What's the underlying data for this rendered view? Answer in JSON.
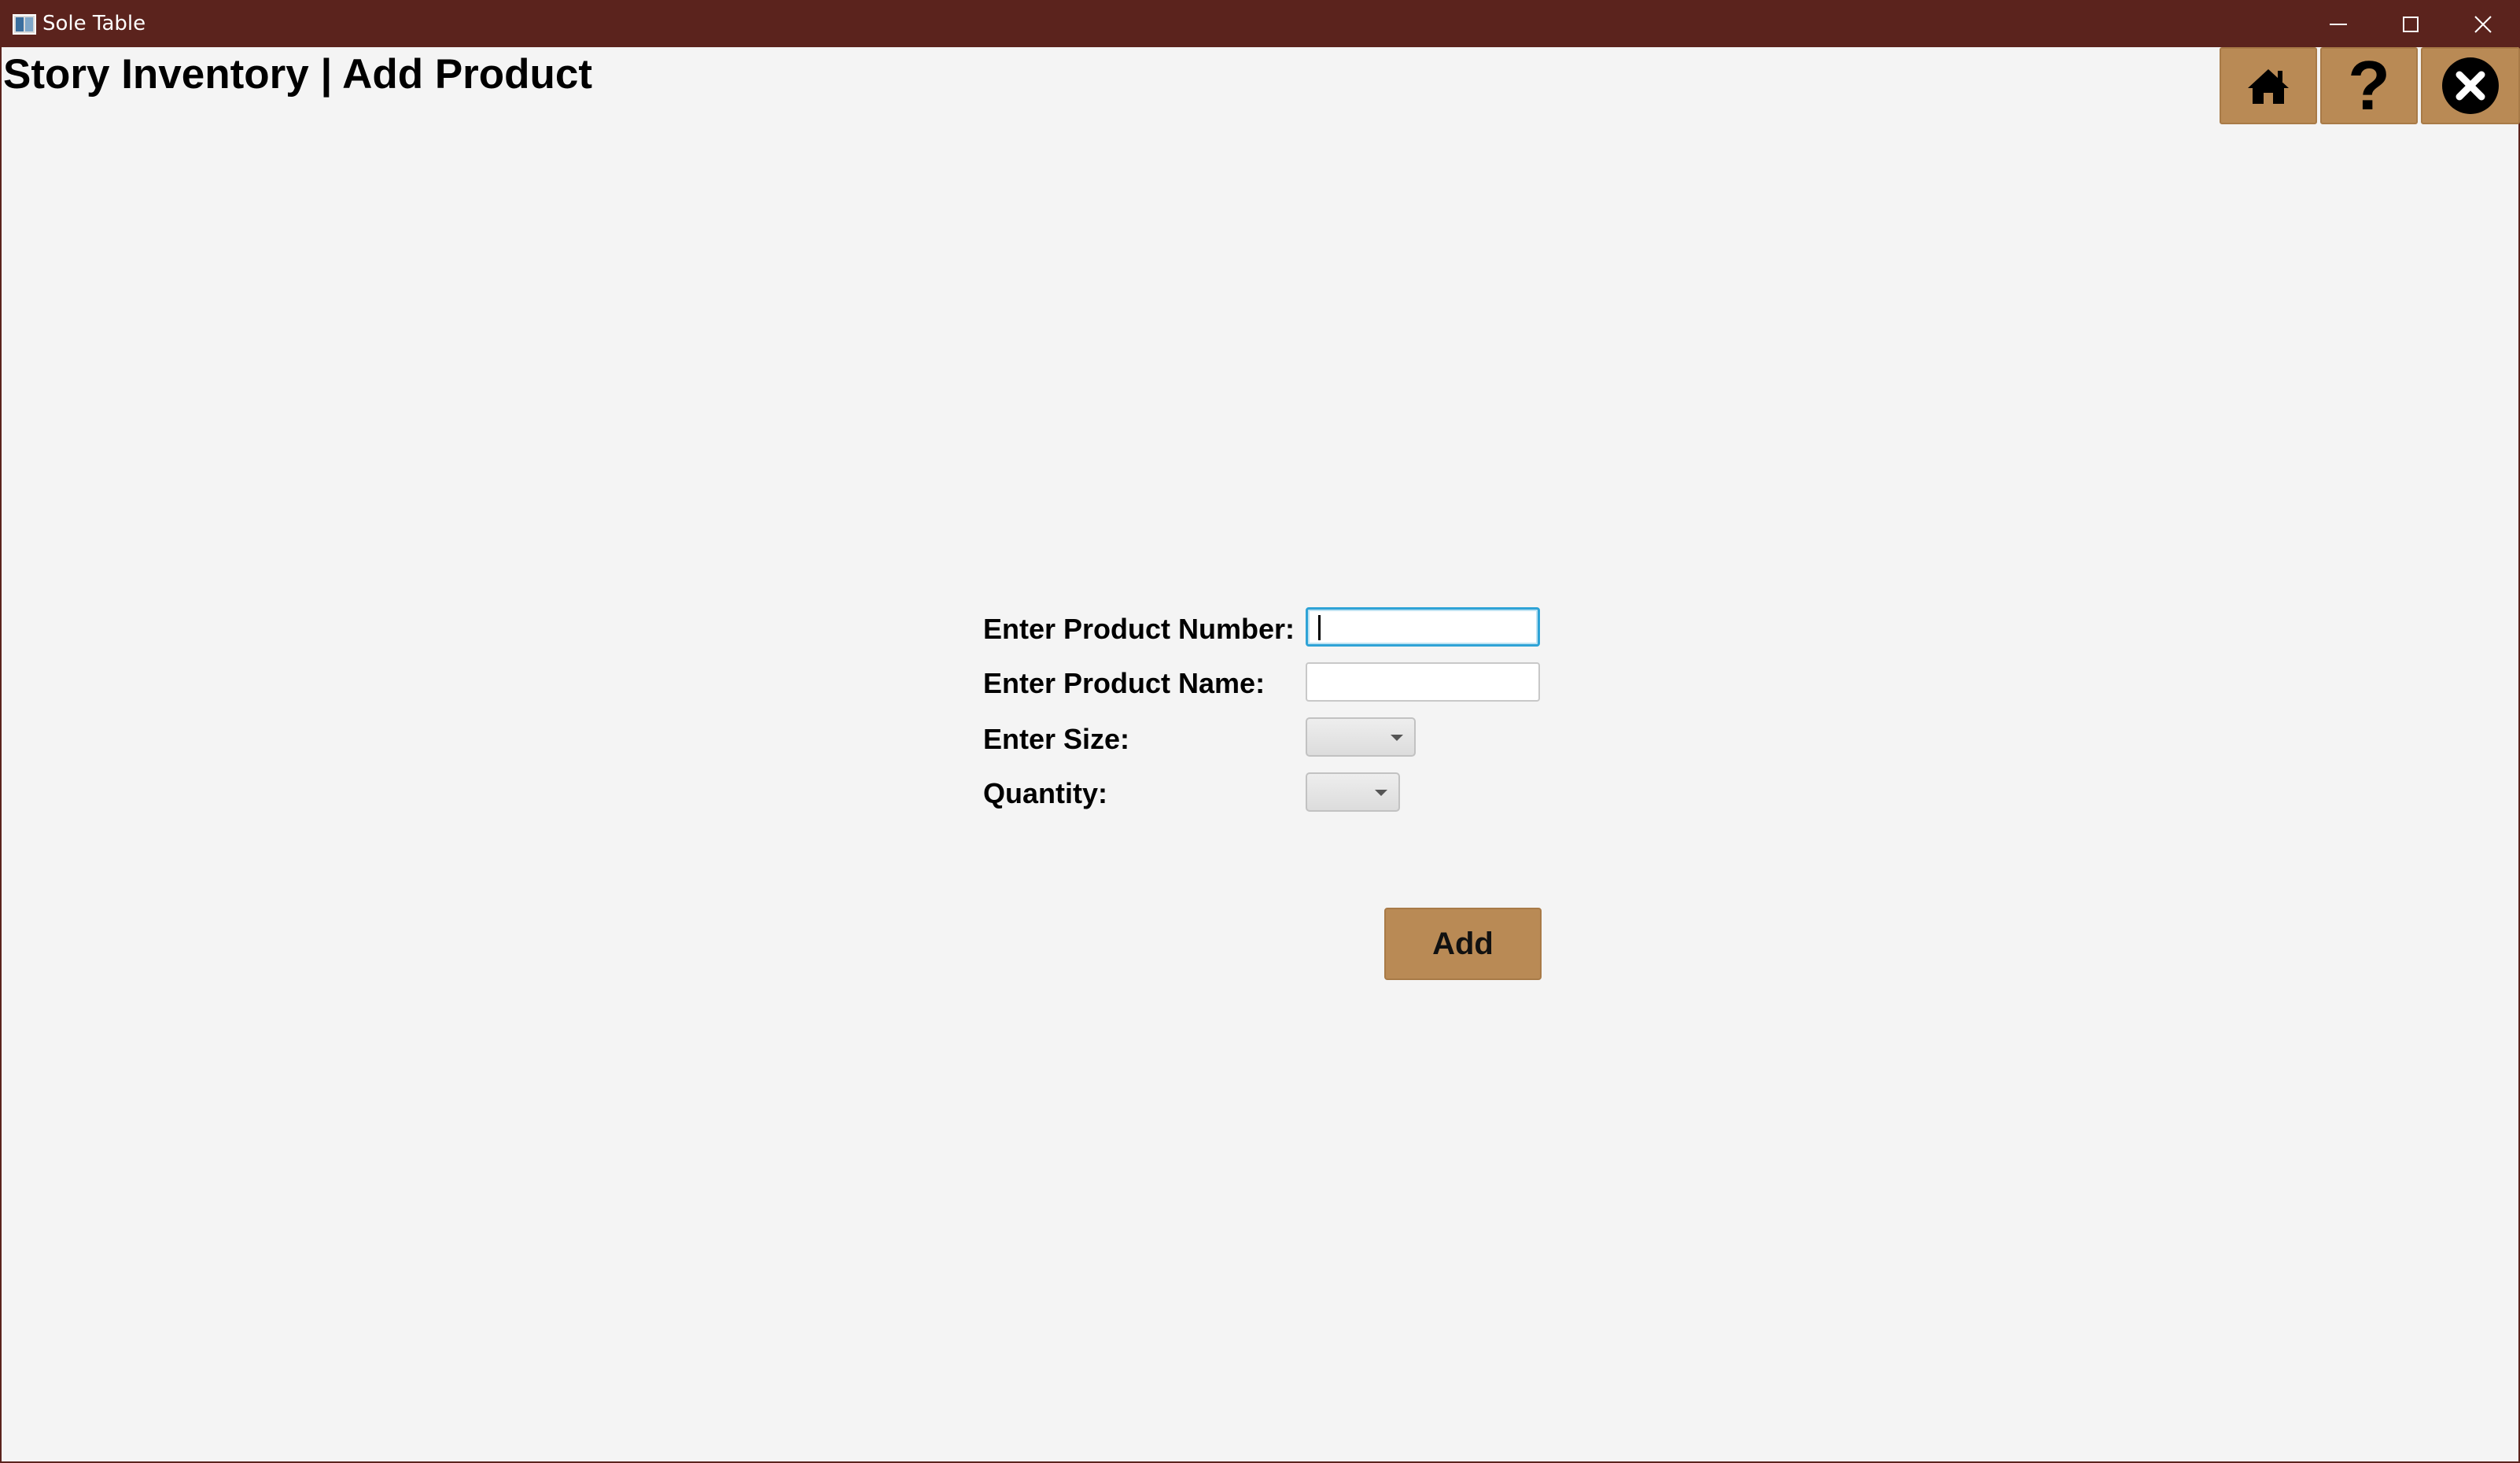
{
  "window": {
    "title": "Sole Table",
    "app_icon": "app-window-icon",
    "controls": {
      "minimize_icon": "minimize-icon",
      "maximize_icon": "maximize-icon",
      "close_icon": "close-icon"
    }
  },
  "header": {
    "title": "Story Inventory | Add Product",
    "nav_buttons": [
      {
        "name": "home",
        "icon": "home-icon"
      },
      {
        "name": "help",
        "icon": "question-mark-icon"
      },
      {
        "name": "close",
        "icon": "close-circle-icon"
      }
    ]
  },
  "form": {
    "product_number_label": "Enter Product Number:",
    "product_number_value": "",
    "product_name_label": "Enter Product Name:",
    "product_name_value": "",
    "size_label": "Enter Size:",
    "size_value": "",
    "quantity_label": "Quantity:",
    "quantity_value": "",
    "add_label": "Add"
  },
  "colors": {
    "titlebar": "#5b231d",
    "accent_button": "#b98a55",
    "background": "#f4f4f4",
    "focus_border": "#2ea3d6"
  }
}
